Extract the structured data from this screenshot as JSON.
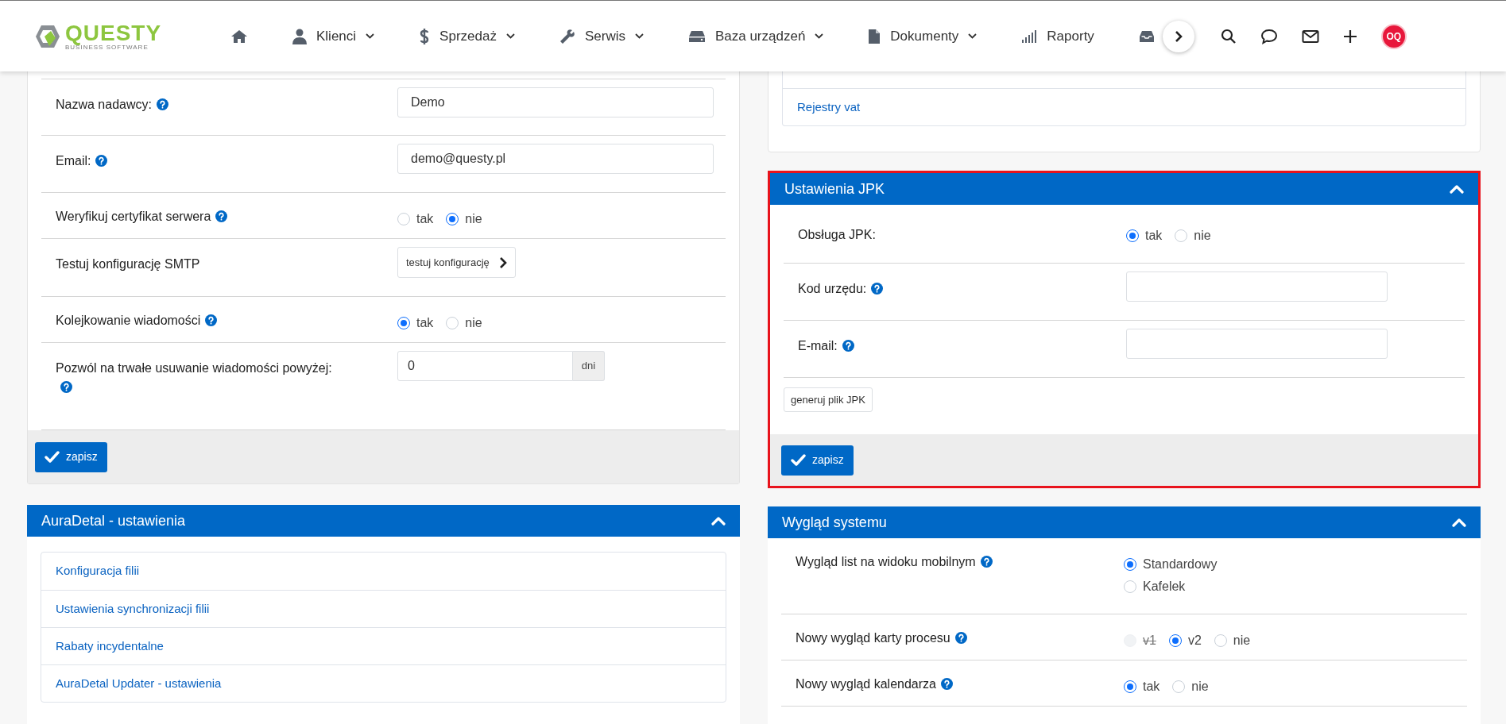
{
  "header": {
    "logo": {
      "name": "QUESTY",
      "tagline": "BUSINESS SOFTWARE"
    },
    "menu": [
      {
        "kind": "icon"
      },
      {
        "kind": "menu",
        "label": "Klienci",
        "dropdown": true
      },
      {
        "kind": "menu",
        "label": "Sprzedaż",
        "dropdown": true
      },
      {
        "kind": "menu",
        "label": "Serwis",
        "dropdown": true
      },
      {
        "kind": "menu",
        "label": "Baza urządzeń",
        "dropdown": true
      },
      {
        "kind": "menu",
        "label": "Dokumenty",
        "dropdown": true
      },
      {
        "kind": "menu",
        "label": "Raporty",
        "dropdown": false
      },
      {
        "kind": "icon"
      }
    ],
    "avatar": "OQ"
  },
  "left": {
    "smtp": {
      "rows": [
        {
          "kind": "text",
          "label": "Nazwa nadawcy:",
          "help": true,
          "value": "Demo"
        },
        {
          "kind": "text",
          "label": "Email:",
          "help": true,
          "value": "demo@questy.pl"
        },
        {
          "kind": "radio",
          "label": "Weryfikuj certyfikat serwera",
          "help": true,
          "options": [
            {
              "label": "tak",
              "selected": false
            },
            {
              "label": "nie",
              "selected": true
            }
          ]
        },
        {
          "kind": "button",
          "label": "Testuj konfigurację SMTP",
          "help": false,
          "button": "testuj konfigurację"
        },
        {
          "kind": "radio",
          "label": "Kolejkowanie wiadomości",
          "help": true,
          "options": [
            {
              "label": "tak",
              "selected": true
            },
            {
              "label": "nie",
              "selected": false
            }
          ]
        },
        {
          "kind": "addon",
          "label": "Pozwól na trwałe usuwanie wiadomości powyżej:",
          "help": true,
          "value": "0",
          "addon": "dni"
        }
      ],
      "save": "zapisz"
    },
    "auradetal": {
      "title": "AuraDetal - ustawienia",
      "expanded": true,
      "links": [
        "Konfiguracja filii",
        "Ustawienia synchronizacji filii",
        "Rabaty incydentalne",
        "AuraDetal Updater - ustawienia"
      ]
    }
  },
  "right": {
    "top_links": [
      "Rejestry vat"
    ],
    "jpk": {
      "title": "Ustawienia JPK",
      "expanded": true,
      "highlighted": true,
      "rows": [
        {
          "kind": "radio",
          "label": "Obsługa JPK:",
          "help": false,
          "options": [
            {
              "label": "tak",
              "selected": true
            },
            {
              "label": "nie",
              "selected": false
            }
          ]
        },
        {
          "kind": "text",
          "label": "Kod urzędu:",
          "help": true,
          "value": ""
        },
        {
          "kind": "text",
          "label": "E-mail:",
          "help": true,
          "value": ""
        }
      ],
      "generate": "generuj plik JPK",
      "save": "zapisz"
    },
    "appearance": {
      "title": "Wygląd systemu",
      "expanded": true,
      "rows": [
        {
          "kind": "radio",
          "label": "Wygląd list na widoku mobilnym",
          "help": true,
          "stacked": true,
          "options": [
            {
              "label": "Standardowy",
              "selected": true
            },
            {
              "label": "Kafelek",
              "selected": false
            }
          ]
        },
        {
          "kind": "radio",
          "label": "Nowy wygląd karty procesu",
          "help": true,
          "stacked": false,
          "options": [
            {
              "label": "v1",
              "selected": false,
              "disabled": true
            },
            {
              "label": "v2",
              "selected": true,
              "disabled": false
            },
            {
              "label": "nie",
              "selected": false,
              "disabled": false
            }
          ]
        },
        {
          "kind": "radio",
          "label": "Nowy wygląd kalendarza",
          "help": true,
          "stacked": false,
          "options": [
            {
              "label": "tak",
              "selected": true
            },
            {
              "label": "nie",
              "selected": false
            }
          ]
        }
      ]
    }
  }
}
